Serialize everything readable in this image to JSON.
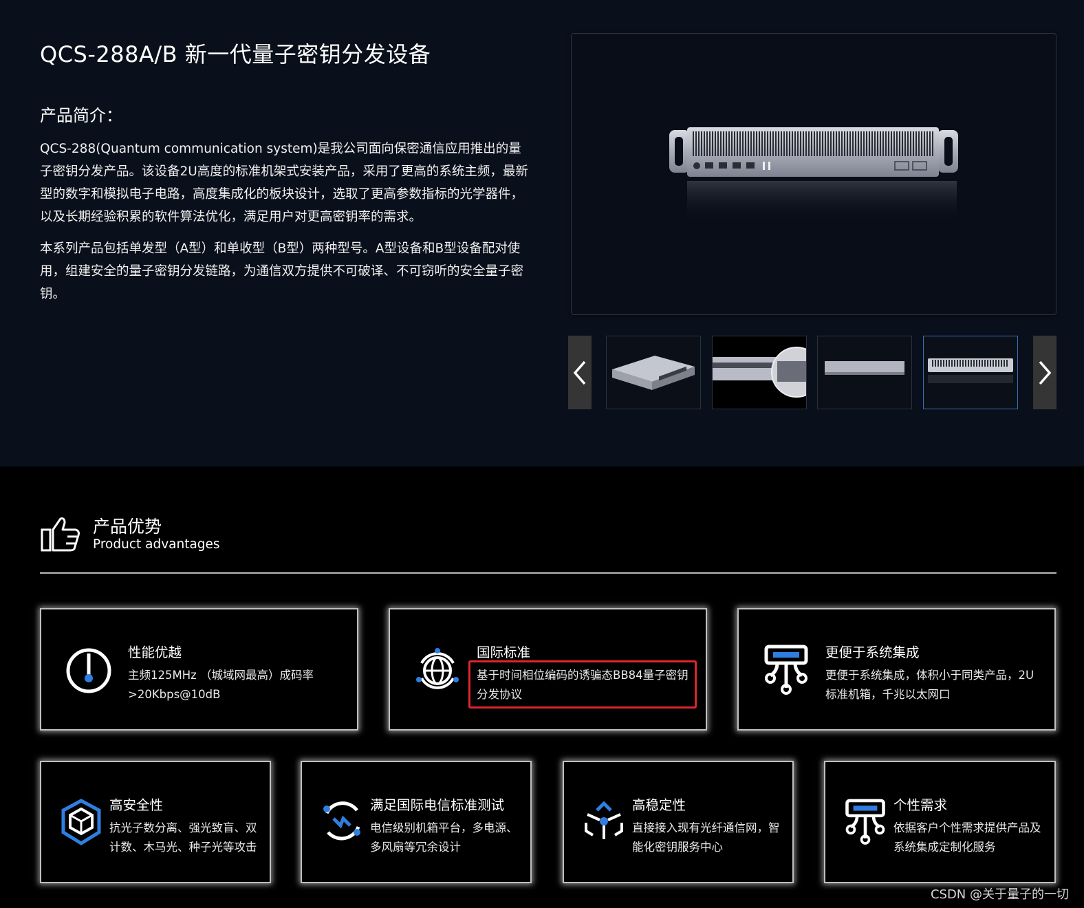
{
  "product": {
    "title": "QCS-288A/B 新一代量子密钥分发设备",
    "intro_heading": "产品简介：",
    "paragraph1": "QCS-288(Quantum communication system)是我公司面向保密通信应用推出的量子密钥分发产品。该设备2U高度的标准机架式安装产品，采用了更高的系统主频，最新型的数字和模拟电子电路，高度集成化的板块设计，选取了更高参数指标的光学器件，以及长期经验积累的软件算法优化，满足用户对更高密钥率的需求。",
    "paragraph2": "本系列产品包括单发型（A型）和单收型（B型）两种型号。A型设备和B型设备配对使用，组建安全的量子密钥分发链路，为通信双方提供不可破译、不可窃听的安全量子密钥。"
  },
  "gallery": {
    "prev_icon": "chevron-left-icon",
    "next_icon": "chevron-right-icon",
    "active_index": 3
  },
  "advantages": {
    "heading": "产品优势",
    "subheading": "Product advantages",
    "header_icon": "thumbs-up-icon",
    "cards_row1": [
      {
        "icon": "gauge-icon",
        "title": "性能优越",
        "desc": "主频125MHz （城域网最高）成码率>20Kbps@10dB"
      },
      {
        "icon": "globe-icon",
        "title": "国际标准",
        "desc": "基于时间相位编码的诱骗态BB84量子密钥分发协议"
      },
      {
        "icon": "network-device-icon",
        "title": "更便于系统集成",
        "desc": "更便于系统集成，体积小于同类产品，2U标准机箱，千兆以太网口"
      }
    ],
    "cards_row2": [
      {
        "icon": "cube-shield-icon",
        "title": "高安全性",
        "desc": "抗光子数分离、强光致盲、双计数、木马光、种子光等攻击"
      },
      {
        "icon": "signal-cycle-icon",
        "title": "满足国际电信标准测试",
        "desc": "电信级别机箱平台，多电源、多风扇等冗余设计"
      },
      {
        "icon": "hub-icon",
        "title": "高稳定性",
        "desc": "直接接入现有光纤通信网，智能化密钥服务中心"
      },
      {
        "icon": "custom-device-icon",
        "title": "个性需求",
        "desc": "依据客户个性需求提供产品及系统集成定制化服务"
      }
    ]
  },
  "watermark": "CSDN @关于量子的一切",
  "colors": {
    "accent_blue": "#2f7fe0",
    "highlight_red": "#e0262a",
    "top_bg": "#0a101b"
  }
}
